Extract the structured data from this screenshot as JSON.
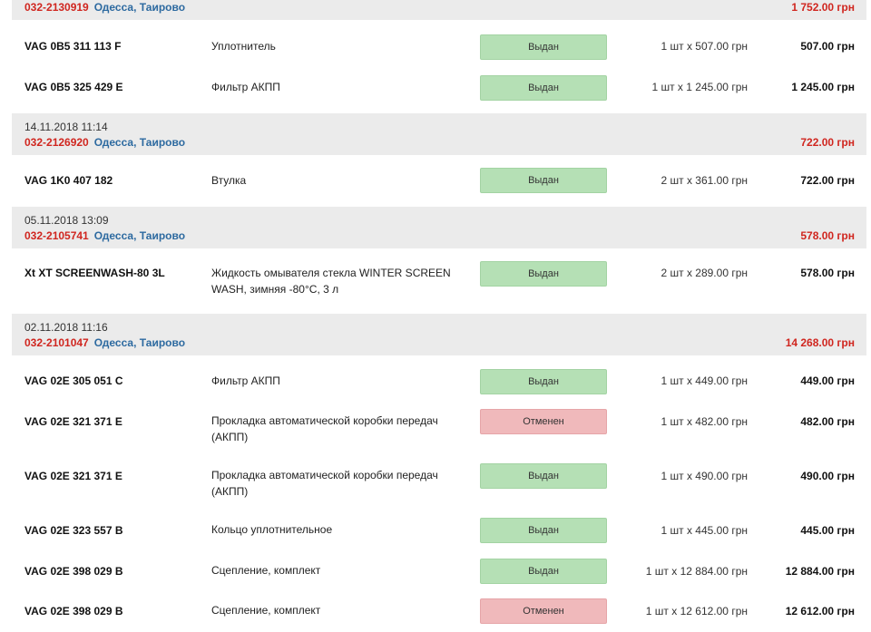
{
  "orders": [
    {
      "date": "",
      "id": "032-2130919",
      "city": "Одесса, Таирово",
      "total": "1 752.00 грн",
      "items": [
        {
          "code": "VAG 0B5 311 113 F",
          "name": "Уплотнитель",
          "status": "Выдан",
          "status_type": "ok",
          "qty": "1 шт x 507.00 грн",
          "sum": "507.00 грн"
        },
        {
          "code": "VAG 0B5 325 429 E",
          "name": "Фильтр АКПП",
          "status": "Выдан",
          "status_type": "ok",
          "qty": "1 шт x 1 245.00 грн",
          "sum": "1 245.00 грн"
        }
      ]
    },
    {
      "date": "14.11.2018 11:14",
      "id": "032-2126920",
      "city": "Одесса, Таирово",
      "total": "722.00 грн",
      "items": [
        {
          "code": "VAG 1K0 407 182",
          "name": "Втулка",
          "status": "Выдан",
          "status_type": "ok",
          "qty": "2 шт x 361.00 грн",
          "sum": "722.00 грн"
        }
      ]
    },
    {
      "date": "05.11.2018 13:09",
      "id": "032-2105741",
      "city": "Одесса, Таирово",
      "total": "578.00 грн",
      "items": [
        {
          "code": "Xt XT SCREENWASH-80 3L",
          "name": "Жидкость омывателя стекла WINTER SCREEN WASH, зимняя -80°C, 3 л",
          "status": "Выдан",
          "status_type": "ok",
          "qty": "2 шт x 289.00 грн",
          "sum": "578.00 грн"
        }
      ]
    },
    {
      "date": "02.11.2018 11:16",
      "id": "032-2101047",
      "city": "Одесса, Таирово",
      "total": "14 268.00 грн",
      "items": [
        {
          "code": "VAG 02E 305 051 C",
          "name": "Фильтр АКПП",
          "status": "Выдан",
          "status_type": "ok",
          "qty": "1 шт x 449.00 грн",
          "sum": "449.00 грн"
        },
        {
          "code": "VAG 02E 321 371 E",
          "name": "Прокладка автоматической коробки передач (АКПП)",
          "status": "Отменен",
          "status_type": "cancel",
          "qty": "1 шт x 482.00 грн",
          "sum": "482.00 грн"
        },
        {
          "code": "VAG 02E 321 371 E",
          "name": "Прокладка автоматической коробки передач (АКПП)",
          "status": "Выдан",
          "status_type": "ok",
          "qty": "1 шт x 490.00 грн",
          "sum": "490.00 грн"
        },
        {
          "code": "VAG 02E 323 557 B",
          "name": "Кольцо уплотнительное",
          "status": "Выдан",
          "status_type": "ok",
          "qty": "1 шт x 445.00 грн",
          "sum": "445.00 грн"
        },
        {
          "code": "VAG 02E 398 029 B",
          "name": "Сцепление, комплект",
          "status": "Выдан",
          "status_type": "ok",
          "qty": "1 шт x 12 884.00 грн",
          "sum": "12 884.00 грн"
        },
        {
          "code": "VAG 02E 398 029 B",
          "name": "Сцепление, комплект",
          "status": "Отменен",
          "status_type": "cancel",
          "qty": "1 шт x 12 612.00 грн",
          "sum": "12 612.00 грн"
        }
      ]
    }
  ]
}
